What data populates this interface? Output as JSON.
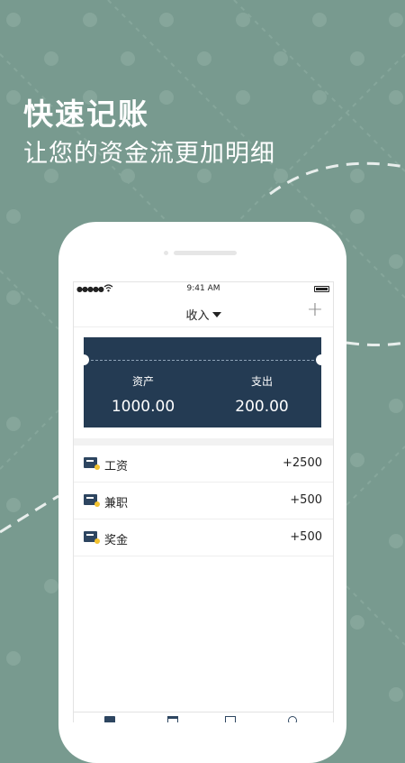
{
  "promo": {
    "headline": "快速记账",
    "subline": "让您的资金流更加明细"
  },
  "status_bar": {
    "signal": "●●●●●",
    "time": "9:41 AM"
  },
  "nav": {
    "title": "收入",
    "add_label": "+"
  },
  "summary": {
    "assets_label": "资产",
    "assets_value": "1000.00",
    "expense_label": "支出",
    "expense_value": "200.00"
  },
  "items": [
    {
      "name": "工资",
      "amount": "+2500"
    },
    {
      "name": "兼职",
      "amount": "+500"
    },
    {
      "name": "奖金",
      "amount": "+500"
    }
  ],
  "colors": {
    "background": "#789a8f",
    "card": "#243b53",
    "accent_icon": "#f2c230"
  },
  "icons": {
    "wifi": "wifi-icon",
    "battery": "battery-icon",
    "dropdown": "caret-down-icon",
    "item": "wallet-icon",
    "tabs": [
      "ledger-icon",
      "calendar-icon",
      "book-icon",
      "search-icon"
    ]
  }
}
